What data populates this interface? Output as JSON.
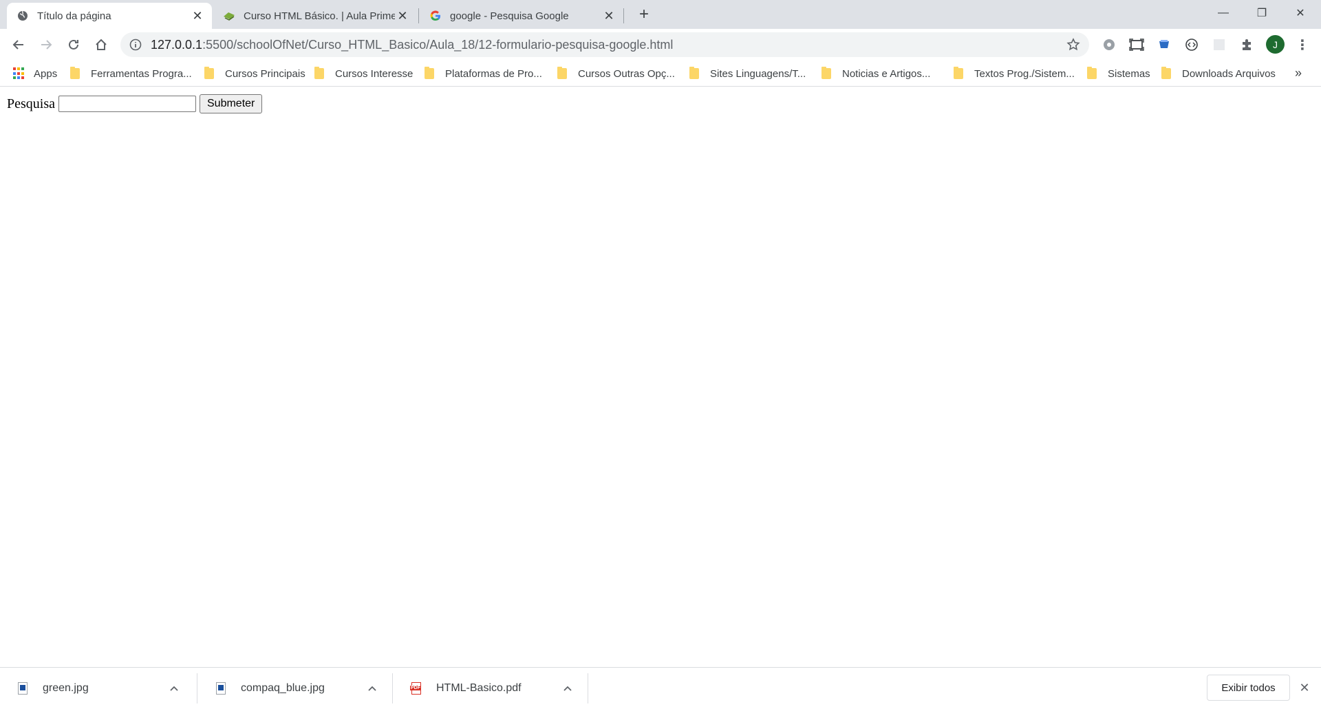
{
  "browser": {
    "tabs": [
      {
        "title": "Título da página",
        "close": "✕"
      },
      {
        "title": "Curso HTML Básico. | Aula Primeira",
        "close": "✕"
      },
      {
        "title": "google - Pesquisa Google",
        "close": "✕"
      }
    ],
    "new_tab": "+",
    "window_controls": {
      "minimize": "—",
      "restore": "❐",
      "close": "✕"
    },
    "url": {
      "host": "127.0.0.1",
      "path": ":5500/schoolOfNet/Curso_HTML_Basico/Aula_18/12-formulario-pesquisa-google.html"
    },
    "profile_initial": "J",
    "more_menu": "⋮"
  },
  "bookmarks": {
    "items": [
      "Apps",
      "Ferramentas Progra...",
      "Cursos Principais",
      "Cursos Interesse",
      "Plataformas de Pro...",
      "Cursos Outras Opç...",
      "Sites Linguagens/T...",
      "Noticias e Artigos...",
      "Textos Prog./Sistem...",
      "Sistemas",
      "Downloads Arquivos"
    ],
    "more": "»"
  },
  "form": {
    "label": "Pesquisa",
    "input_value": "",
    "submit_label": "Submeter"
  },
  "downloads": {
    "items": [
      {
        "name": "green.jpg",
        "type": "image"
      },
      {
        "name": "compaq_blue.jpg",
        "type": "image"
      },
      {
        "name": "HTML-Basico.pdf",
        "type": "pdf"
      }
    ],
    "show_all": "Exibir todos",
    "close": "✕"
  },
  "colors": {
    "tabstrip": "#dee1e6",
    "omnibox": "#f1f3f4",
    "folder": "#fcd667",
    "avatar": "#1e6b30"
  }
}
